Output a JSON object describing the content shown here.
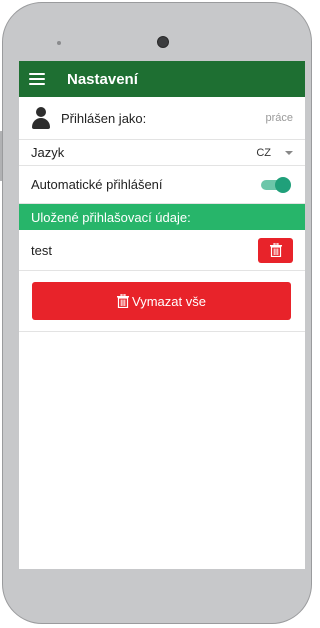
{
  "appbar": {
    "title": "Nastavení",
    "menu_icon": "hamburger-icon",
    "background": "#1e6f32"
  },
  "settings": {
    "user_label": "Přihlášen jako:",
    "user_value": "práce",
    "user_icon": "user-icon",
    "language_label": "Jazyk",
    "language_value": "CZ",
    "auto_login_label": "Automatické přihlášení",
    "auto_login_enabled": true
  },
  "saved_credentials": {
    "header": "Uložené přihlašovací údaje:",
    "header_color": "#27b56a",
    "items": [
      {
        "name": "test",
        "delete_icon": "trash-icon"
      }
    ]
  },
  "actions": {
    "clear_all_label": "Vymazat vše",
    "clear_all_icon": "trash-icon",
    "danger_color": "#e8232a"
  }
}
